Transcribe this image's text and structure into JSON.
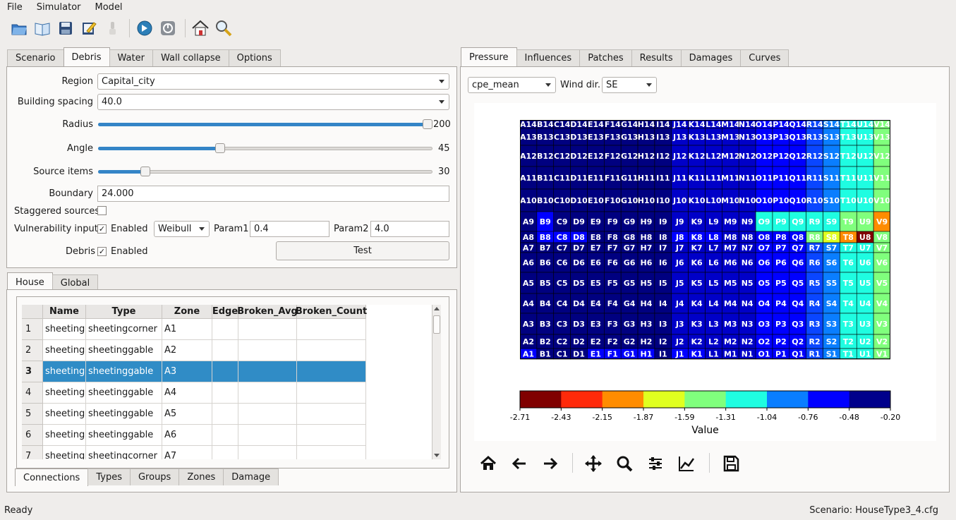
{
  "menu": [
    "File",
    "Simulator",
    "Model"
  ],
  "toolbar": {
    "icons": [
      "open-folder-icon",
      "open-book-icon",
      "save-icon",
      "edit-icon",
      "paint-icon",
      "run-icon",
      "stop-icon",
      "home-icon",
      "zoom-icon"
    ]
  },
  "left_tabs": [
    "Scenario",
    "Debris",
    "Water",
    "Wall collapse",
    "Options"
  ],
  "left_active": "Debris",
  "debris": {
    "region_label": "Region",
    "region_value": "Capital_city",
    "spacing_label": "Building spacing",
    "spacing_value": "40.0",
    "radius_label": "Radius",
    "radius_value": "200",
    "radius_frac": 1.0,
    "angle_label": "Angle",
    "angle_value": "45",
    "angle_frac": 0.36,
    "source_label": "Source items",
    "source_value": "30",
    "source_frac": 0.13,
    "boundary_label": "Boundary",
    "boundary_value": "24.000",
    "staggered_label": "Staggered sources",
    "vuln_label": "Vulnerability input",
    "vuln_enabled": "Enabled",
    "vuln_dist": "Weibull",
    "param1_label": "Param1",
    "param1_value": "0.4",
    "param2_label": "Param2",
    "param2_value": "4.0",
    "debris_label": "Debris",
    "debris_enabled": "Enabled",
    "test_button": "Test"
  },
  "house_tabs": [
    "House",
    "Global"
  ],
  "table": {
    "columns": [
      "Name",
      "Type",
      "Zone",
      "Edge",
      "Broken_Avg",
      "Broken_Count"
    ],
    "rows": [
      {
        "n": "1",
        "name": "sheeting",
        "type": "sheetingcorner",
        "zone": "A1"
      },
      {
        "n": "2",
        "name": "sheeting",
        "type": "sheetinggable",
        "zone": "A2"
      },
      {
        "n": "3",
        "name": "sheeting",
        "type": "sheetinggable",
        "zone": "A3"
      },
      {
        "n": "4",
        "name": "sheeting",
        "type": "sheetinggable",
        "zone": "A4"
      },
      {
        "n": "5",
        "name": "sheeting",
        "type": "sheetinggable",
        "zone": "A5"
      },
      {
        "n": "6",
        "name": "sheeting",
        "type": "sheetinggable",
        "zone": "A6"
      },
      {
        "n": "7",
        "name": "sheeting",
        "type": "sheetingcorner",
        "zone": "A7"
      }
    ],
    "selected_row": "3"
  },
  "bottom_tabs": [
    "Connections",
    "Types",
    "Groups",
    "Zones",
    "Damage"
  ],
  "right_tabs": [
    "Pressure",
    "Influences",
    "Patches",
    "Results",
    "Damages",
    "Curves"
  ],
  "pressure": {
    "combo": "cpe_mean",
    "wind_label": "Wind dir.",
    "wind_value": "SE"
  },
  "chart_data": {
    "type": "heatmap",
    "columns": [
      "A",
      "B",
      "C",
      "D",
      "E",
      "F",
      "G",
      "H",
      "I",
      "J",
      "K",
      "L",
      "M",
      "N",
      "O",
      "P",
      "Q",
      "R",
      "S",
      "T",
      "U",
      "V"
    ],
    "rows": [
      14,
      13,
      12,
      11,
      10,
      9,
      8,
      7,
      6,
      5,
      4,
      3,
      2,
      1
    ],
    "color_bins": [
      0,
      0,
      0,
      0,
      0,
      0,
      0,
      0,
      0,
      1,
      1,
      1,
      1,
      1,
      2,
      2,
      2,
      3,
      4,
      5,
      5,
      6
    ],
    "highlights": {
      "R9": 5,
      "S9": 5,
      "T9": 6,
      "U9": 6,
      "V9": 8,
      "R8": 6,
      "S8": 7,
      "T8": 8,
      "U8": 9,
      "V8": 6,
      "A1": 2,
      "E1": 2,
      "F1": 2,
      "G1": 2,
      "H1": 2,
      "J1": 2,
      "K1": 2,
      "J2": 1,
      "K2": 1,
      "B9": 2,
      "B8": 2,
      "C8": 2,
      "D8": 2,
      "J8": 2,
      "K8": 2,
      "L8": 2,
      "M8": 1,
      "N8": 1,
      "O9": 5,
      "P9": 5,
      "Q9": 5
    },
    "colorbar": {
      "ticks": [
        "-2.71",
        "-2.43",
        "-2.15",
        "-1.87",
        "-1.59",
        "-1.31",
        "-1.04",
        "-0.76",
        "-0.48",
        "-0.20"
      ],
      "colors": [
        "#800000",
        "#ff2a0a",
        "#ff8c00",
        "#e0ff1f",
        "#80ff7d",
        "#1ffde1",
        "#0a7eff",
        "#0000ff",
        "#00008b"
      ],
      "label": "Value"
    }
  },
  "cell_colors": [
    "#000080",
    "#0000c8",
    "#0000ff",
    "#0a46ff",
    "#0a7eff",
    "#1ffde1",
    "#80ff7d",
    "#e0ff1f",
    "#ff8c00",
    "#800000"
  ],
  "status": {
    "left": "Ready",
    "right": "Scenario: HouseType3_4.cfg"
  }
}
